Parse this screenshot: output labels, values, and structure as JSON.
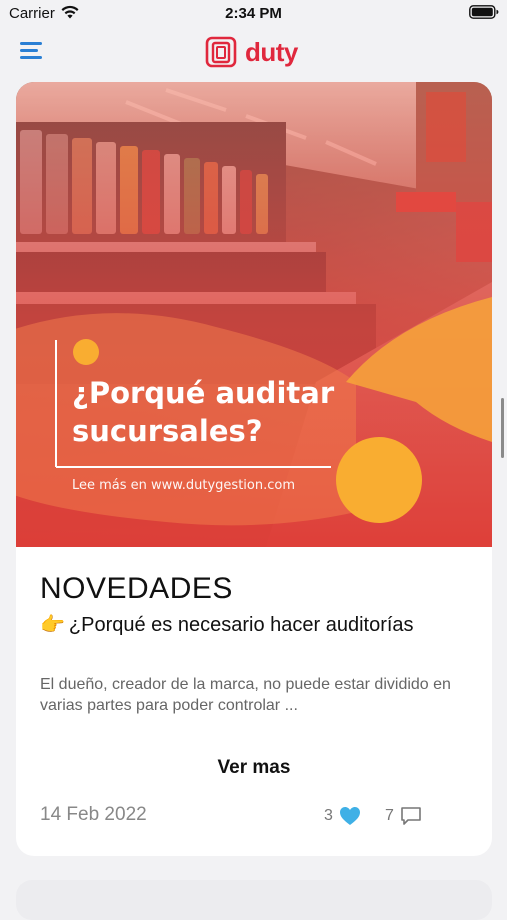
{
  "status_bar": {
    "carrier": "Carrier",
    "time": "2:34 PM",
    "wifi_icon": "wifi-icon",
    "battery_icon": "battery-icon"
  },
  "header": {
    "menu_icon": "hamburger-menu-icon",
    "logo_text": "duty",
    "brand_color": "#e0283d",
    "accent_color": "#2a7fd4"
  },
  "post": {
    "image": {
      "headline": "¿Porqué auditar sucursales?",
      "caption": "Lee más en www.dutygestion.com"
    },
    "title": "NOVEDADES",
    "subtitle_icon": "pointing-hand-icon",
    "subtitle_emoji": "👉",
    "subtitle": "¿Porqué es necesario hacer auditorías",
    "description": "El dueño, creador de la marca, no puede estar dividido en varias partes para poder controlar ...",
    "more_label": "Ver mas",
    "date": "14 Feb 2022",
    "likes": "3",
    "like_color": "#3fb0e6",
    "comments": "7"
  }
}
